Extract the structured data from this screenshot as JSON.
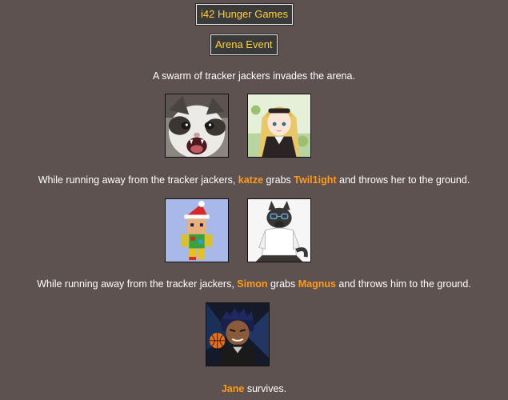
{
  "header": {
    "title": "i42 Hunger Games",
    "event": "Arena Event"
  },
  "intro": "A swarm of tracker jackers invades the arena.",
  "events": [
    {
      "prefix": "While running away from the tracker jackers, ",
      "actor": "katze",
      "middle": " grabs ",
      "target": "Twil1ight",
      "suffix": " and throws her to the ground."
    },
    {
      "prefix": "While running away from the tracker jackers, ",
      "actor": "Simon",
      "middle": " grabs ",
      "target": "Magnus",
      "suffix": " and throws him to the ground."
    },
    {
      "actor": "Jane",
      "suffix": " survives."
    }
  ],
  "colors": {
    "background": "#5e5250",
    "name": "#ff9a1a",
    "title_text": "#ffd040"
  },
  "avatars": {
    "katze": "screaming-cat-avatar",
    "twil": "anime-girl-avatar",
    "simon": "blocky-santa-avatar",
    "magnus": "cartoon-wolf-avatar",
    "jane": "basketball-player-avatar"
  }
}
